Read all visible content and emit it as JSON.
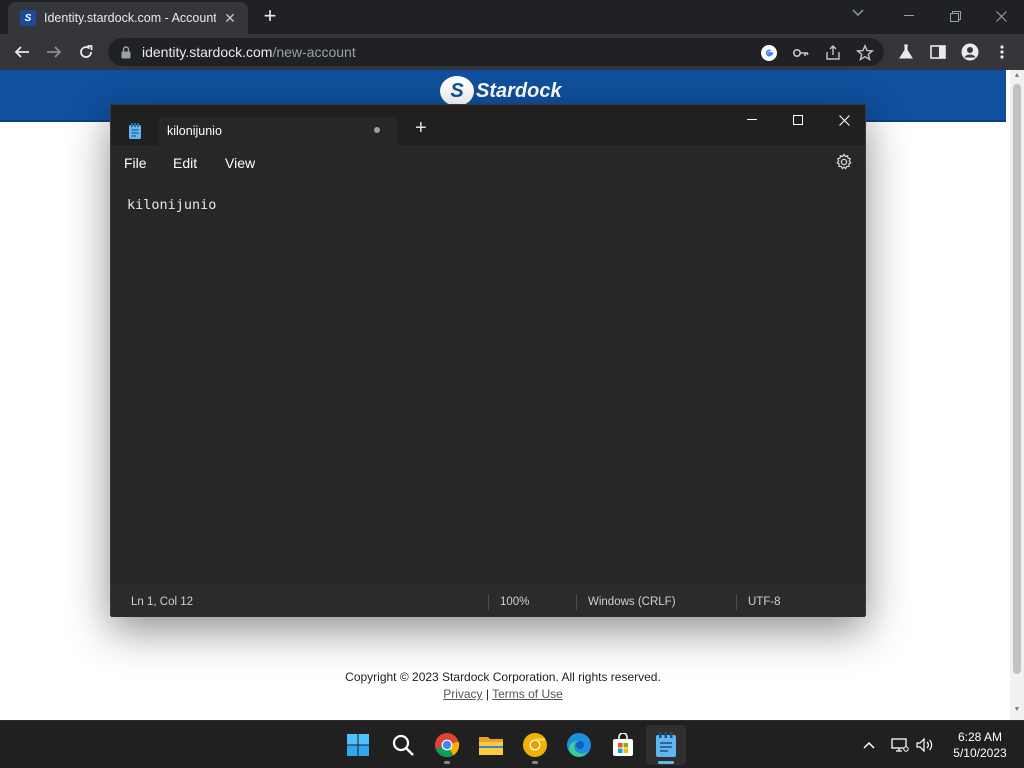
{
  "browser": {
    "tab_title": "Identity.stardock.com - Account",
    "tab_favicon_letter": "S",
    "url_host": "identity.stardock.com",
    "url_path": "/new-account"
  },
  "page": {
    "brand_mark": "S",
    "brand_name": "Stardock",
    "copyright": "Copyright © 2023 Stardock Corporation. All rights reserved.",
    "link_privacy": "Privacy",
    "link_separator": "|",
    "link_terms": "Terms of Use"
  },
  "notepad": {
    "tab_title": "kilonijunio",
    "menu": [
      "File",
      "Edit",
      "View"
    ],
    "content": "kilonijunio",
    "status": {
      "position": "Ln 1, Col 12",
      "zoom": "100%",
      "line_ending": "Windows (CRLF)",
      "encoding": "UTF-8"
    }
  },
  "taskbar": {
    "apps": [
      "windows-start-icon",
      "search-icon",
      "chrome-icon",
      "file-explorer-icon",
      "chrome-canary-icon",
      "edge-icon",
      "microsoft-store-icon",
      "notepad-icon"
    ],
    "time": "6:28 AM",
    "date": "5/10/2023"
  },
  "colors": {
    "page_header": "#10509e",
    "notepad_bg": "#272727",
    "taskbar_bg": "#202020",
    "active_indicator": "#62b9f0"
  }
}
